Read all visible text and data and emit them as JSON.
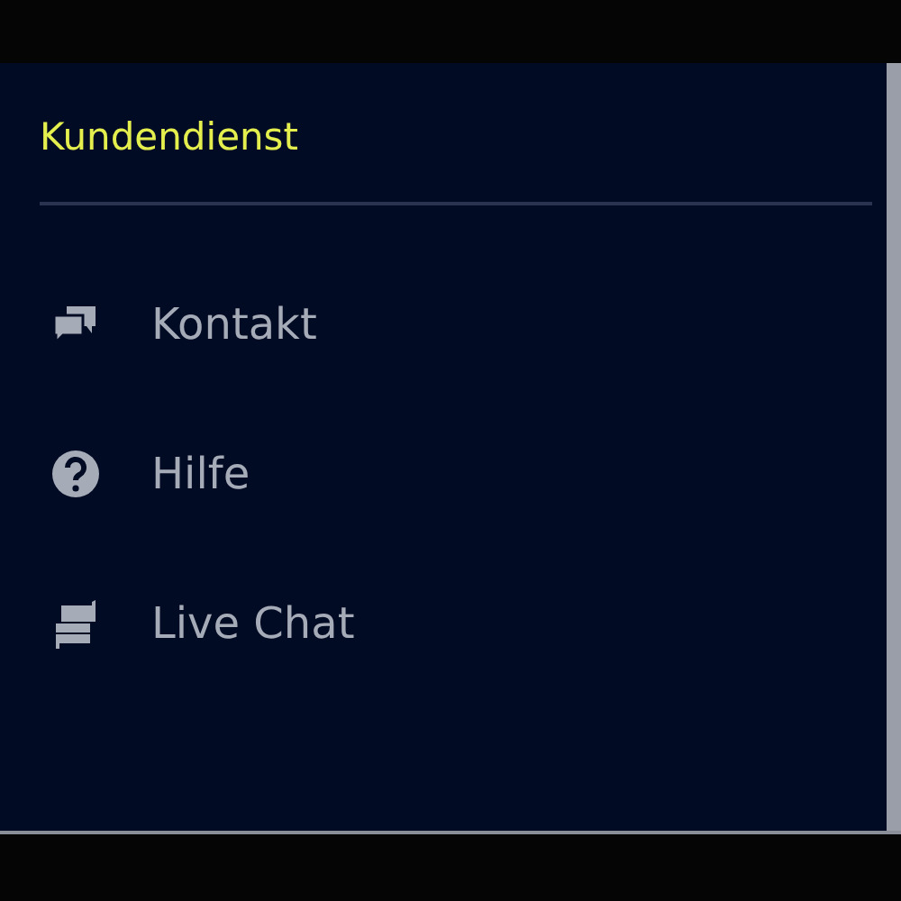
{
  "panel": {
    "title": "Kundendienst",
    "items": [
      {
        "kind": "contact",
        "label": "Kontakt"
      },
      {
        "kind": "help",
        "label": "Hilfe"
      },
      {
        "kind": "chat",
        "label": "Live Chat"
      }
    ]
  }
}
